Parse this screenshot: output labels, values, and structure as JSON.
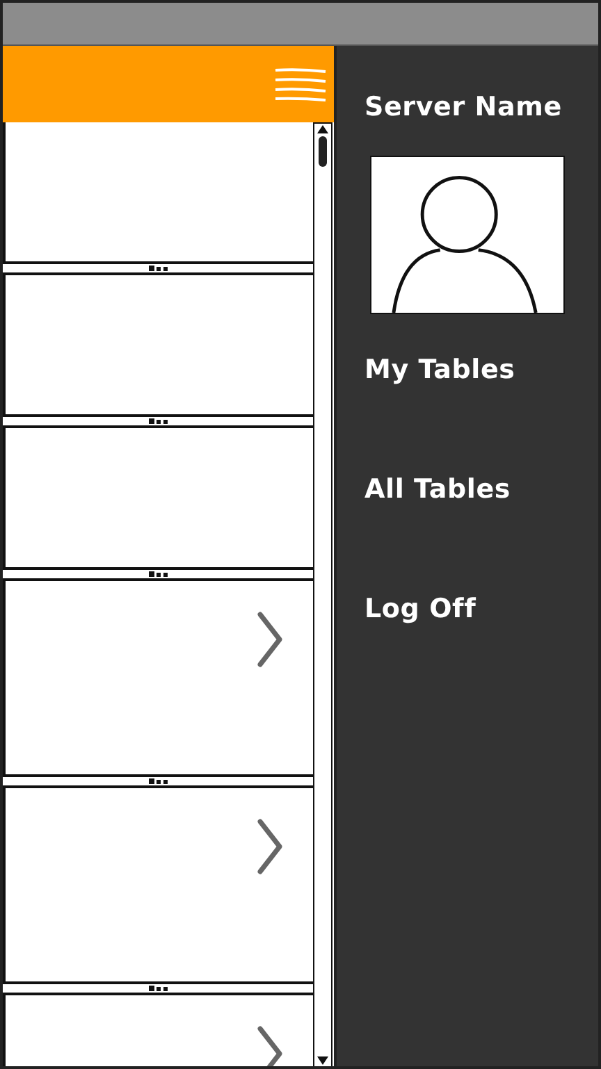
{
  "list": {
    "rows": [
      {
        "kind": "plain"
      },
      {
        "kind": "plain"
      },
      {
        "kind": "plain"
      },
      {
        "kind": "chevron"
      },
      {
        "kind": "chevron"
      },
      {
        "kind": "chevron"
      }
    ]
  },
  "drawer": {
    "title": "Server Name",
    "items": [
      {
        "label": "My Tables"
      },
      {
        "label": "All Tables"
      },
      {
        "label": "Log Off"
      }
    ]
  }
}
